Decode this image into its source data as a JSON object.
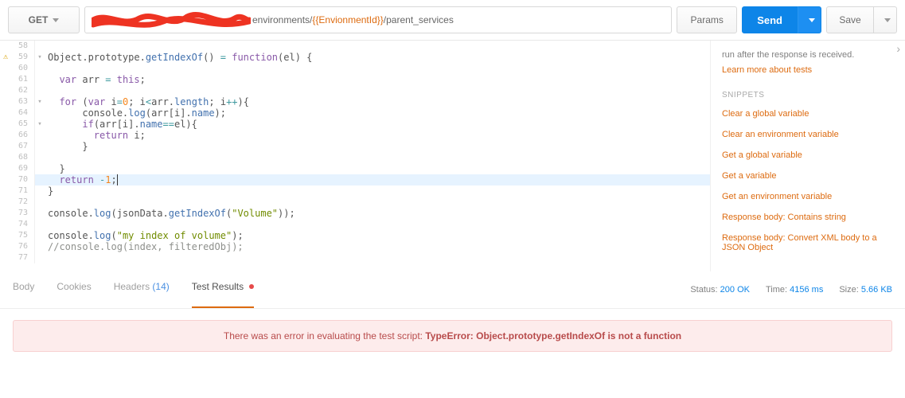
{
  "toolbar": {
    "method": "GET",
    "url_prefix": "environments/",
    "url_var": "{{EnvionmentId}}",
    "url_suffix": "/parent_services",
    "params": "Params",
    "send": "Send",
    "save": "Save"
  },
  "editor": {
    "lines": [
      {
        "n": 58,
        "fold": "",
        "code": ""
      },
      {
        "n": 59,
        "fold": "▾",
        "warn": true,
        "html": "Object.prototype.<span class='c-prop'>getIndexOf</span>() <span class='c-op'>=</span> <span class='c-kw'>function</span>(el) {"
      },
      {
        "n": 60,
        "fold": "",
        "code": ""
      },
      {
        "n": 61,
        "fold": "",
        "html": "  <span class='c-kw'>var</span> arr <span class='c-op'>=</span> <span class='c-kw'>this</span>;"
      },
      {
        "n": 62,
        "fold": "",
        "code": ""
      },
      {
        "n": 63,
        "fold": "▾",
        "html": "  <span class='c-kw'>for</span> (<span class='c-kw'>var</span> i<span class='c-op'>=</span><span class='c-num'>0</span>; i<span class='c-op'>&lt;</span>arr.<span class='c-prop'>length</span>; i<span class='c-op'>++</span>){"
      },
      {
        "n": 64,
        "fold": "",
        "html": "      console.<span class='c-prop'>log</span>(arr[i].<span class='c-prop'>name</span>);"
      },
      {
        "n": 65,
        "fold": "▾",
        "html": "      <span class='c-kw'>if</span>(arr[i].<span class='c-prop'>name</span><span class='c-op'>==</span>el){"
      },
      {
        "n": 66,
        "fold": "",
        "html": "        <span class='c-kw'>return</span> i;"
      },
      {
        "n": 67,
        "fold": "",
        "html": "      }"
      },
      {
        "n": 68,
        "fold": "",
        "code": ""
      },
      {
        "n": 69,
        "fold": "",
        "html": "  }"
      },
      {
        "n": 70,
        "fold": "",
        "hl": true,
        "html": "  <span class='c-kw'>return</span> <span class='c-op'>-</span><span class='c-num'>1</span>;<span class='cursor'></span>"
      },
      {
        "n": 71,
        "fold": "",
        "html": "}"
      },
      {
        "n": 72,
        "fold": "",
        "code": ""
      },
      {
        "n": 73,
        "fold": "",
        "html": "console.<span class='c-prop'>log</span>(jsonData.<span class='c-prop'>getIndexOf</span>(<span class='c-str'>\"Volume\"</span>));"
      },
      {
        "n": 74,
        "fold": "",
        "code": ""
      },
      {
        "n": 75,
        "fold": "",
        "html": "console.<span class='c-prop'>log</span>(<span class='c-str'>\"my index of volume\"</span>);"
      },
      {
        "n": 76,
        "fold": "",
        "html": "<span class='c-comm'>//console.log(index, filteredObj);</span>"
      },
      {
        "n": 77,
        "fold": "",
        "code": ""
      }
    ]
  },
  "sidebar": {
    "desc": "run after the response is received.",
    "learn": "Learn more about tests",
    "snippets_head": "SNIPPETS",
    "snippets": [
      "Clear a global variable",
      "Clear an environment variable",
      "Get a global variable",
      "Get a variable",
      "Get an environment variable",
      "Response body: Contains string",
      "Response body: Convert XML body to a JSON Object"
    ]
  },
  "tabs": {
    "body": "Body",
    "cookies": "Cookies",
    "headers": "Headers",
    "headers_count": "(14)",
    "tests": "Test Results"
  },
  "status": {
    "status_lbl": "Status:",
    "status_val": "200 OK",
    "time_lbl": "Time:",
    "time_val": "4156 ms",
    "size_lbl": "Size:",
    "size_val": "5.66 KB"
  },
  "error": {
    "msg": "There was an error in evaluating the test script:  ",
    "detail": "TypeError: Object.prototype.getIndexOf is not a function"
  }
}
